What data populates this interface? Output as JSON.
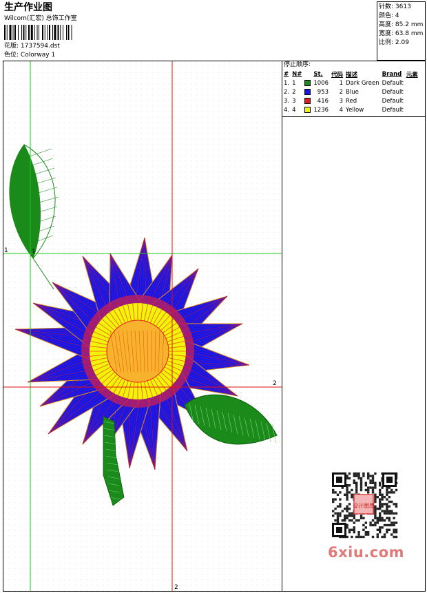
{
  "header": {
    "title": "生产作业图",
    "company": "Wilcom(汇宏) 总饰工作室",
    "design_label": "花版:",
    "design_value": "1737594.dst",
    "colorway_label": "色位:",
    "colorway_value": "Colorway 1"
  },
  "stats": [
    {
      "label": "针数",
      "value": "3613"
    },
    {
      "label": "颜色",
      "value": "4"
    },
    {
      "label": "高度",
      "value": "85.2 mm"
    },
    {
      "label": "宽度",
      "value": "63.8 mm"
    },
    {
      "label": "比例",
      "value": "2.09"
    }
  ],
  "stop_sequence": {
    "title": "停止顺序:",
    "columns": [
      "#",
      "N#",
      "St.",
      "代码",
      "描述",
      "Brand",
      "元素"
    ],
    "rows": [
      {
        "order": "1.",
        "n": "1",
        "color": "#1a8a1a",
        "stitches": "1006",
        "code": "1",
        "description": "Dark Green",
        "brand": "Default"
      },
      {
        "order": "2.",
        "n": "2",
        "color": "#1616e6",
        "stitches": "953",
        "code": "2",
        "description": "Blue",
        "brand": "Default"
      },
      {
        "order": "3.",
        "n": "3",
        "color": "#e61a1a",
        "stitches": "416",
        "code": "3",
        "description": "Red",
        "brand": "Default"
      },
      {
        "order": "4.",
        "n": "4",
        "color": "#f2f20a",
        "stitches": "1236",
        "code": "4",
        "description": "Yellow",
        "brand": "Default"
      }
    ]
  },
  "canvas": {
    "axis_labels": {
      "h1": "1",
      "v1": "1",
      "h2": "2",
      "v2": "2"
    },
    "guide_green": "#19c819",
    "guide_red": "#e01010"
  },
  "watermark": "6xiu.com",
  "qr_seal_text": "设计图库"
}
